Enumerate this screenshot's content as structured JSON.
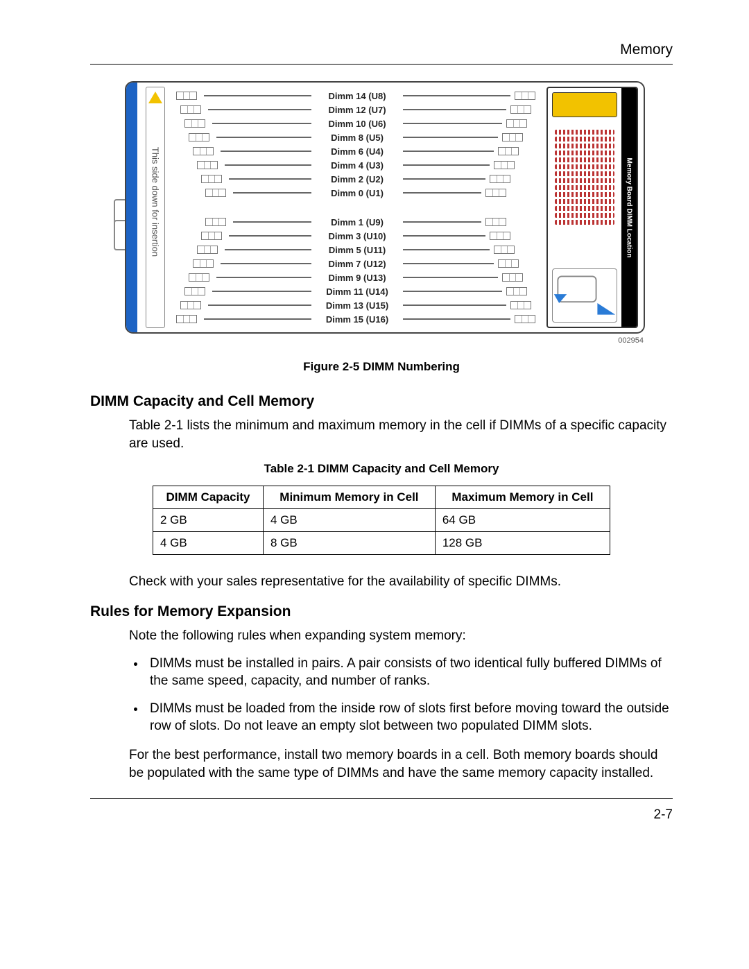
{
  "header": {
    "section_title": "Memory"
  },
  "diagram": {
    "side_text": "This side down for insertion",
    "panel_label": "Memory Board DIMM Location",
    "id_code": "002954",
    "slots_top": [
      "Dimm 14 (U8)",
      "Dimm 12 (U7)",
      "Dimm 10 (U6)",
      "Dimm 8 (U5)",
      "Dimm 6 (U4)",
      "Dimm 4 (U3)",
      "Dimm 2 (U2)",
      "Dimm 0 (U1)"
    ],
    "slots_bottom": [
      "Dimm 1 (U9)",
      "Dimm 3 (U10)",
      "Dimm 5 (U11)",
      "Dimm 7 (U12)",
      "Dimm 9 (U13)",
      "Dimm 11 (U14)",
      "Dimm 13 (U15)",
      "Dimm 15 (U16)"
    ]
  },
  "fig_caption": "Figure 2-5 DIMM Numbering",
  "sect1": {
    "heading": "DIMM Capacity and Cell Memory",
    "para": "Table 2-1 lists the minimum and maximum memory in the cell if DIMMs of a specific capacity are used."
  },
  "table": {
    "caption": "Table 2-1 DIMM Capacity and Cell Memory",
    "headers": [
      "DIMM Capacity",
      "Minimum Memory in Cell",
      "Maximum Memory in Cell"
    ],
    "rows": [
      [
        "2 GB",
        "4 GB",
        "64 GB"
      ],
      [
        "4 GB",
        "8 GB",
        "128 GB"
      ]
    ]
  },
  "after_table": "Check with your sales representative for the availability of specific DIMMs.",
  "sect2": {
    "heading": "Rules for Memory Expansion",
    "intro": "Note the following rules when expanding system memory:",
    "bullets": [
      "DIMMs must be installed in pairs. A pair consists of two identical fully buffered DIMMs of the same speed, capacity, and number of ranks.",
      "DIMMs must be loaded from the inside row of slots first before moving toward the outside row of slots. Do not leave an empty slot between two populated DIMM slots."
    ],
    "closing": "For the best performance, install two memory boards in a cell. Both memory boards should be populated with the same type of DIMMs and have the same memory capacity installed."
  },
  "page_number": "2-7"
}
